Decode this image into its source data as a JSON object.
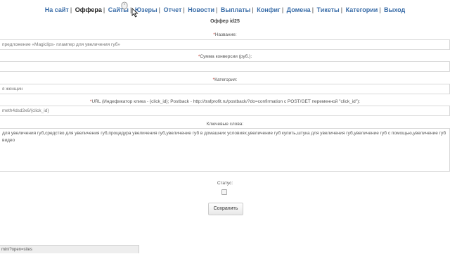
{
  "nav": {
    "items": [
      {
        "label": "На сайт"
      },
      {
        "label": "Оффера",
        "active": true
      },
      {
        "label": "Сайты"
      },
      {
        "label": "Юзеры"
      },
      {
        "label": "Отчет"
      },
      {
        "label": "Новости"
      },
      {
        "label": "Выплаты"
      },
      {
        "label": "Конфиг"
      },
      {
        "label": "Домена"
      },
      {
        "label": "Тикеты"
      },
      {
        "label": "Категории"
      },
      {
        "label": "Выход"
      }
    ],
    "separator": "|"
  },
  "page_title": "Оффер id25",
  "form": {
    "required_mark": "*",
    "name_label": "Название:",
    "name_value": "предложение «Magiclips- плампер для увеличения губ»",
    "conversion_label": "Сумма конверсии (руб.):",
    "conversion_value": "",
    "category_label": "Категория:",
    "category_value": "я женщин",
    "url_label": "URL (Индефикатор клика - {click_id}; Postback - http://trafprofit.ru/postback/?do=confirmation с POST/GET переменной \"click_id\"):",
    "url_value": "meth4dsd3x6/{click_id}",
    "keywords_label": "Ключевые слова:",
    "keywords_value": "для увеличения губ,средство для увеличения губ,процедура увеличения губ,увеличение губ в домашних условиях,увеличение губ купить,штука для увеличения губ,увеличение губ с помощью,увеличение губ видео",
    "status_label": "Статус:",
    "status_checked": false,
    "save_label": "Сохранить"
  },
  "status_bar": {
    "text": "min/?open=sites"
  },
  "colors": {
    "link": "#3a6da8",
    "active_link": "#222222",
    "required": "#c0392b"
  }
}
